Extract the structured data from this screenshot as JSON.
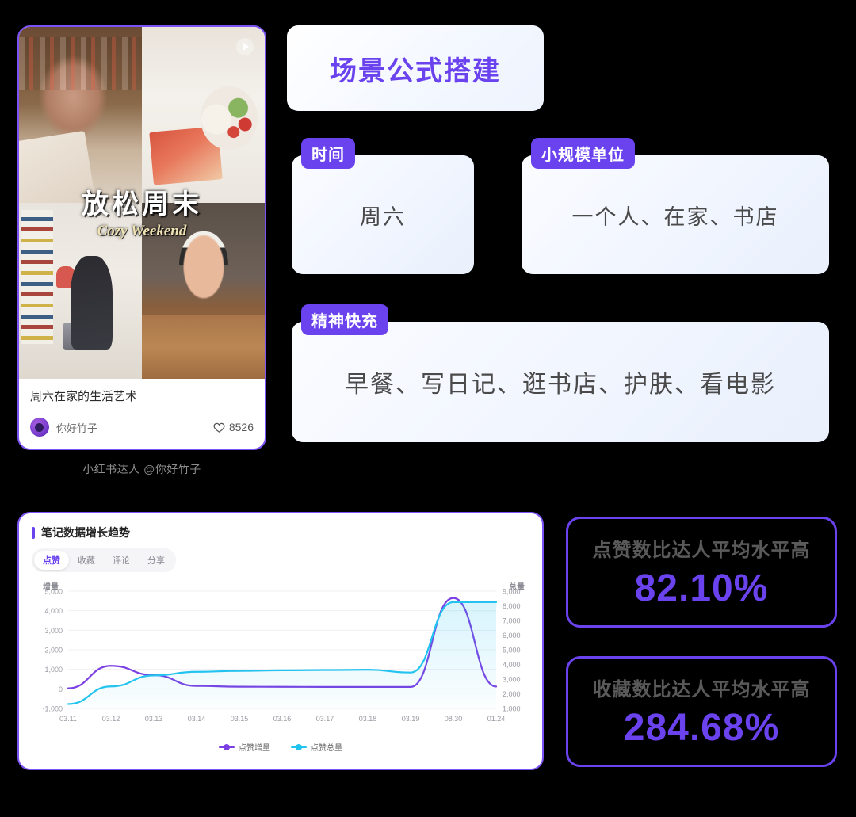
{
  "theme": {
    "background": "#000000",
    "accent_purple": "#6a43ef",
    "border_purple": "#7b52f5",
    "line_increment": "#7b3fe4",
    "line_total": "#22c3ef"
  },
  "note": {
    "thumbnail_overlay_cn": "放松周末",
    "thumbnail_overlay_en": "Cozy Weekend",
    "play_icon": "play-icon",
    "title": "周六在家的生活艺术",
    "author": "你好竹子",
    "avatar_icon": "avatar-icon",
    "like_icon": "heart-icon",
    "likes": "8526",
    "caption": "小红书达人 @你好竹子"
  },
  "formula": {
    "title": "场景公式搭建",
    "fields": [
      {
        "tag": "时间",
        "value": "周六"
      },
      {
        "tag": "小规模单位",
        "value": "一个人、在家、书店"
      },
      {
        "tag": "精神快充",
        "value": "早餐、写日记、逛书店、护肤、看电影"
      }
    ]
  },
  "chart_panel": {
    "title": "笔记数据增长趋势",
    "tabs": [
      {
        "label": "点赞",
        "active": true
      },
      {
        "label": "收藏",
        "active": false
      },
      {
        "label": "评论",
        "active": false
      },
      {
        "label": "分享",
        "active": false
      }
    ]
  },
  "chart_data": {
    "type": "line",
    "title": "笔记数据增长趋势",
    "xlabel": "",
    "ylabel": "增量",
    "y2label": "总量",
    "grid": true,
    "legend_position": "bottom",
    "categories": [
      "03.11",
      "03.12",
      "03.13",
      "03.14",
      "03.15",
      "03.16",
      "03.17",
      "03.18",
      "03.19",
      "08.30",
      "01.24"
    ],
    "ylim": [
      -1000,
      5000
    ],
    "yticks": [
      "5,000",
      "4,000",
      "3,000",
      "2,000",
      "1,000",
      "0",
      "-1,000"
    ],
    "y2lim": [
      1000,
      9000
    ],
    "y2ticks": [
      "9,000",
      "8,000",
      "7,000",
      "6,000",
      "5,000",
      "4,000",
      "3,000",
      "2,000",
      "1,000"
    ],
    "series": [
      {
        "name": "点赞增量",
        "color": "#7b3fe4",
        "axis": "left",
        "values": [
          30,
          1180,
          700,
          150,
          110,
          105,
          100,
          100,
          100,
          4650,
          120
        ]
      },
      {
        "name": "点赞总量",
        "color": "#22c3ef",
        "axis": "right",
        "values": [
          1300,
          2500,
          3250,
          3500,
          3560,
          3600,
          3620,
          3640,
          3450,
          8250,
          8250
        ]
      }
    ]
  },
  "stats": [
    {
      "label": "点赞数比达人平均水平高",
      "value": "82.10%"
    },
    {
      "label": "收藏数比达人平均水平高",
      "value": "284.68%"
    }
  ]
}
